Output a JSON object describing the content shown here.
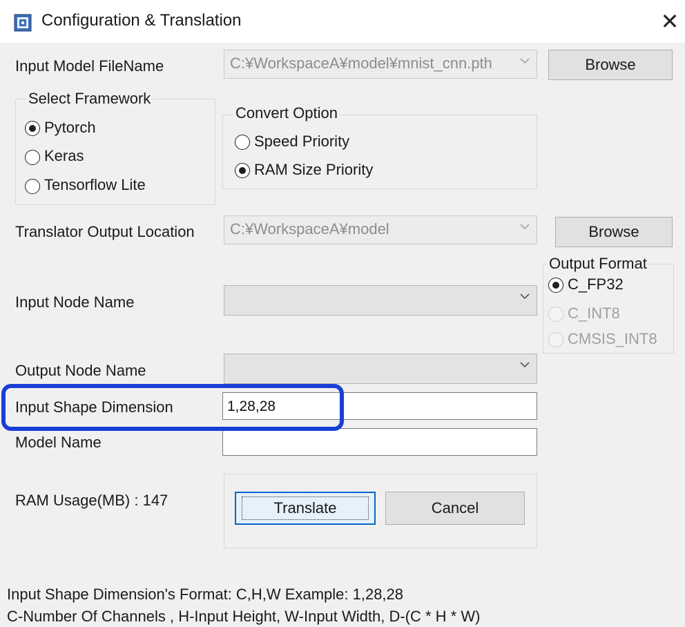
{
  "window": {
    "title": "Configuration & Translation",
    "close_glyph": "✕",
    "icon": "app-chip-icon"
  },
  "model_file": {
    "label": "Input Model FileName",
    "value": "C:¥WorkspaceA¥model¥mnist_cnn.pth",
    "browse_label": "Browse"
  },
  "framework": {
    "title": "Select Framework",
    "options": [
      {
        "label": "Pytorch",
        "checked": true
      },
      {
        "label": "Keras",
        "checked": false
      },
      {
        "label": "Tensorflow Lite",
        "checked": false
      }
    ]
  },
  "convert_option": {
    "title": "Convert Option",
    "options": [
      {
        "label": "Speed Priority",
        "checked": false
      },
      {
        "label": "RAM Size Priority",
        "checked": true
      }
    ]
  },
  "output_location": {
    "label": "Translator Output Location",
    "value": "C:¥WorkspaceA¥model",
    "browse_label": "Browse"
  },
  "output_format": {
    "title": "Output Format",
    "options": [
      {
        "label": "C_FP32",
        "checked": true,
        "enabled": true
      },
      {
        "label": "C_INT8",
        "checked": false,
        "enabled": false
      },
      {
        "label": "CMSIS_INT8",
        "checked": false,
        "enabled": false
      }
    ]
  },
  "input_node": {
    "label": "Input Node Name",
    "value": ""
  },
  "output_node": {
    "label": "Output Node Name",
    "value": ""
  },
  "input_shape": {
    "label": "Input Shape Dimension",
    "value": "1,28,28"
  },
  "model_name": {
    "label": "Model Name",
    "value": ""
  },
  "ram_usage": {
    "text": "RAM Usage(MB) : 147"
  },
  "actions": {
    "translate_label": "Translate",
    "cancel_label": "Cancel"
  },
  "footer": {
    "line1": "Input Shape Dimension's Format: C,H,W Example: 1,28,28",
    "line2": "C-Number Of Channels , H-Input Height, W-Input Width, D-(C * H * W)"
  },
  "colors": {
    "highlight": "#1a3fd6",
    "client_bg": "#f0f0f0",
    "title_bg": "#ffffff"
  }
}
